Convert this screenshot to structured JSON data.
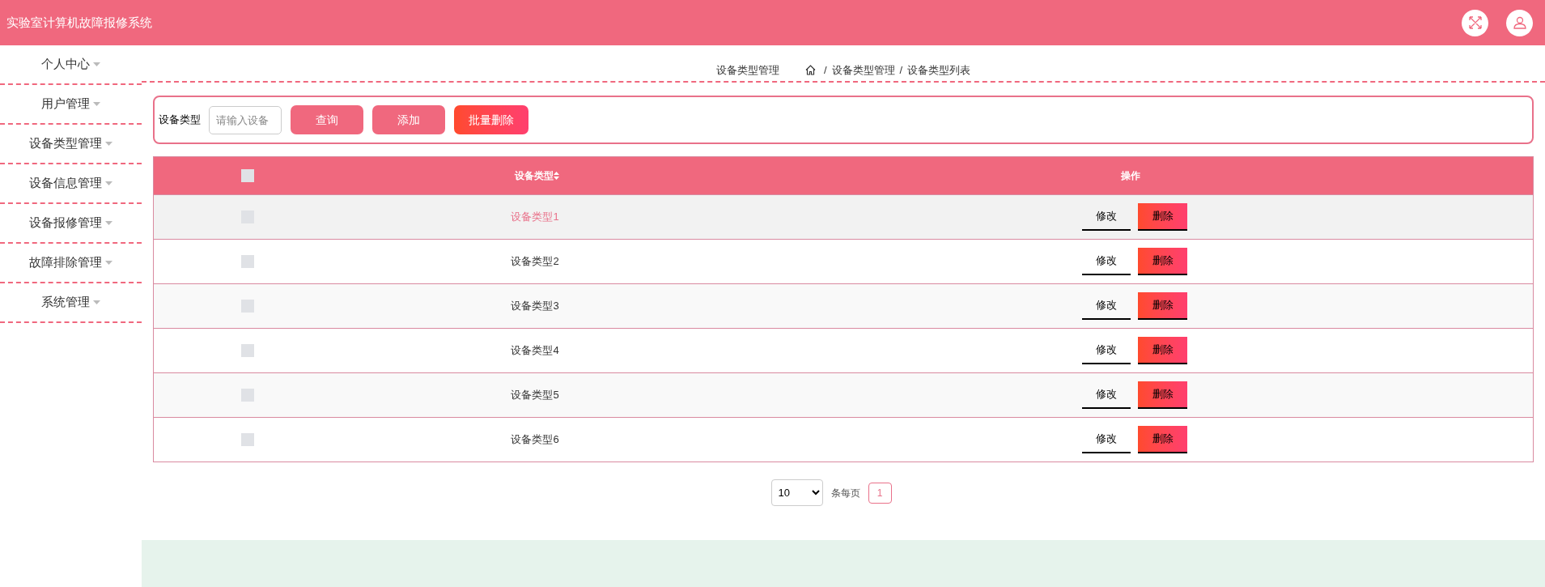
{
  "header": {
    "title": "实验室计算机故障报修系统"
  },
  "sidebar": {
    "items": [
      {
        "label": "个人中心"
      },
      {
        "label": "用户管理"
      },
      {
        "label": "设备类型管理"
      },
      {
        "label": "设备信息管理"
      },
      {
        "label": "设备报修管理"
      },
      {
        "label": "故障排除管理"
      },
      {
        "label": "系统管理"
      }
    ]
  },
  "breadcrumb": {
    "title": "设备类型管理",
    "path": [
      "设备类型管理",
      "设备类型列表"
    ],
    "separator": "/"
  },
  "search": {
    "label": "设备类型",
    "placeholder": "请输入设备",
    "buttons": [
      {
        "label": "查询",
        "kind": "primary"
      },
      {
        "label": "添加",
        "kind": "primary"
      },
      {
        "label": "批量删除",
        "kind": "danger"
      }
    ]
  },
  "table": {
    "columns": [
      "设备类型",
      "操作"
    ],
    "header_checked": false,
    "rows": [
      {
        "type": "设备类型1",
        "checked": false,
        "highlighted": true,
        "actions": [
          "修改",
          "删除"
        ]
      },
      {
        "type": "设备类型2",
        "checked": false,
        "highlighted": false,
        "actions": [
          "修改",
          "删除"
        ]
      },
      {
        "type": "设备类型3",
        "checked": false,
        "highlighted": false,
        "actions": [
          "修改",
          "删除"
        ]
      },
      {
        "type": "设备类型4",
        "checked": false,
        "highlighted": false,
        "actions": [
          "修改",
          "删除"
        ]
      },
      {
        "type": "设备类型5",
        "checked": false,
        "highlighted": false,
        "actions": [
          "修改",
          "删除"
        ]
      },
      {
        "type": "设备类型6",
        "checked": false,
        "highlighted": false,
        "actions": [
          "修改",
          "删除"
        ]
      }
    ]
  },
  "pagination": {
    "page_size": "10",
    "page_size_label": "条每页",
    "pages": [
      {
        "label": "1",
        "selected": true
      }
    ]
  }
}
